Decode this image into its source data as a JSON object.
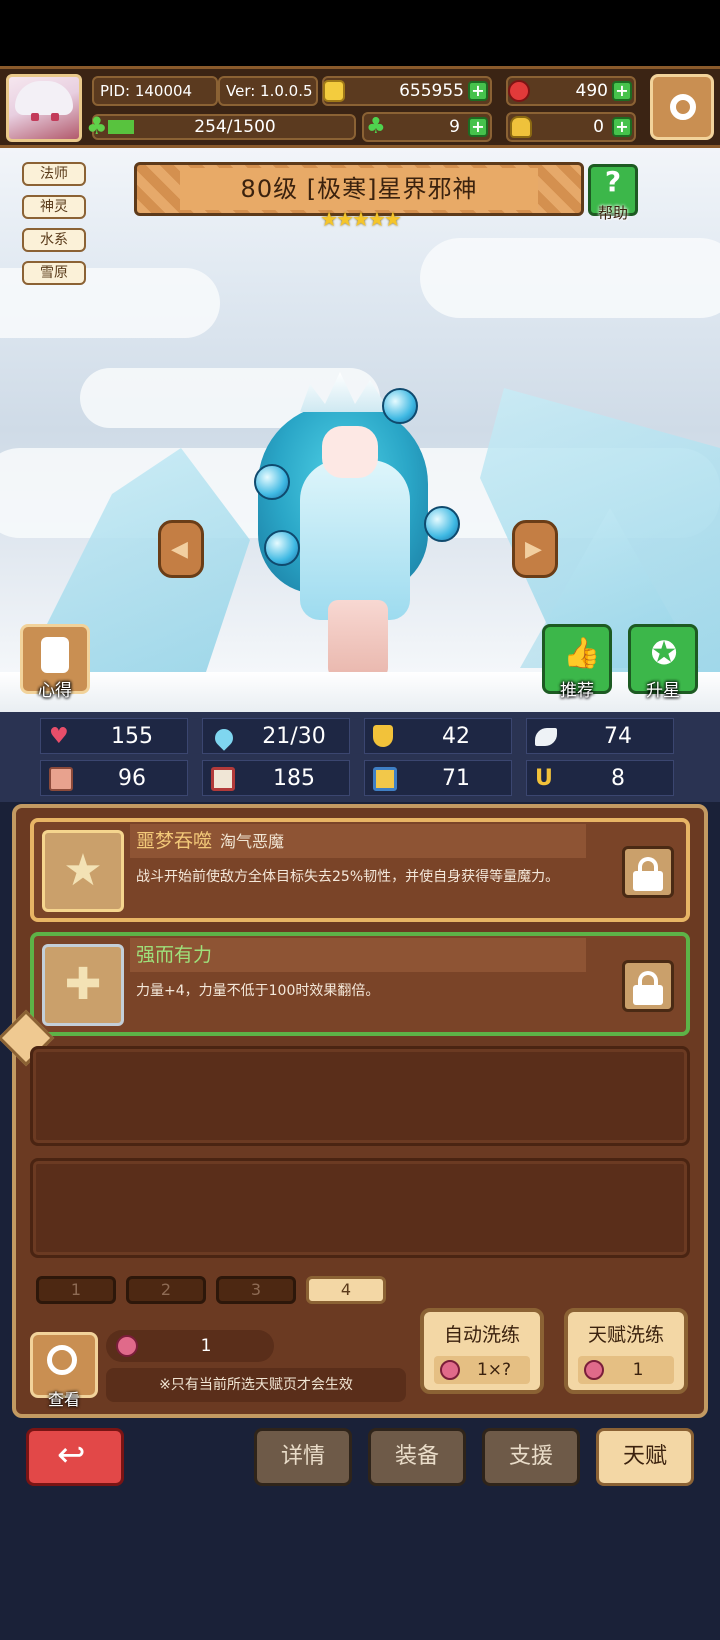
{
  "top_bar": {
    "pid": "PID: 140004",
    "version": "Ver: 1.0.0.5",
    "gold": "655955",
    "gems": "490",
    "xp": "254/1500",
    "clover": "9",
    "bag": "0"
  },
  "tags": [
    "法师",
    "神灵",
    "水系",
    "雪原"
  ],
  "hero": {
    "title": "80级 [极寒]星界邪神",
    "stars": "★★★★★",
    "star_count": 5,
    "help_label": "帮助"
  },
  "side_buttons": {
    "left_label": "心得",
    "recommend_label": "推荐",
    "upgrade_label": "升星"
  },
  "stats": [
    {
      "icon": "heart-icon",
      "value": "155"
    },
    {
      "icon": "droplet-icon",
      "value": "21/30"
    },
    {
      "icon": "shield-icon",
      "value": "42"
    },
    {
      "icon": "wing-icon",
      "value": "74"
    },
    {
      "icon": "fist-icon",
      "value": "96"
    },
    {
      "icon": "book-icon",
      "value": "185"
    },
    {
      "icon": "scroll-icon",
      "value": "71"
    },
    {
      "icon": "horseshoe-icon",
      "value": "8"
    }
  ],
  "talents": [
    {
      "name": "噩梦吞噬",
      "subtitle": "淘气恶魔",
      "description": "战斗开始前使敌方全体目标失去25%韧性，并使自身获得等量魔力。",
      "icon": "star-icon"
    },
    {
      "name": "强而有力",
      "subtitle": "",
      "description": "力量+4，力量不低于100时效果翻倍。",
      "icon": "cross-icon"
    }
  ],
  "pages": [
    "1",
    "2",
    "3",
    "4"
  ],
  "active_page": "4",
  "controls": {
    "look_label": "查看",
    "fruit_count": "1",
    "note": "※只有当前所选天赋页才会生效",
    "auto_wash_label": "自动洗练",
    "auto_wash_cost": "1×?",
    "talent_wash_label": "天赋洗练",
    "talent_wash_cost": "1"
  },
  "nav": {
    "details": "详情",
    "equip": "装备",
    "support": "支援",
    "talent": "天赋"
  },
  "colors": {
    "accent_gold": "#e8b565",
    "panel_brown": "#6b3a22",
    "active_green": "#5db347",
    "back_red": "#e24848"
  }
}
